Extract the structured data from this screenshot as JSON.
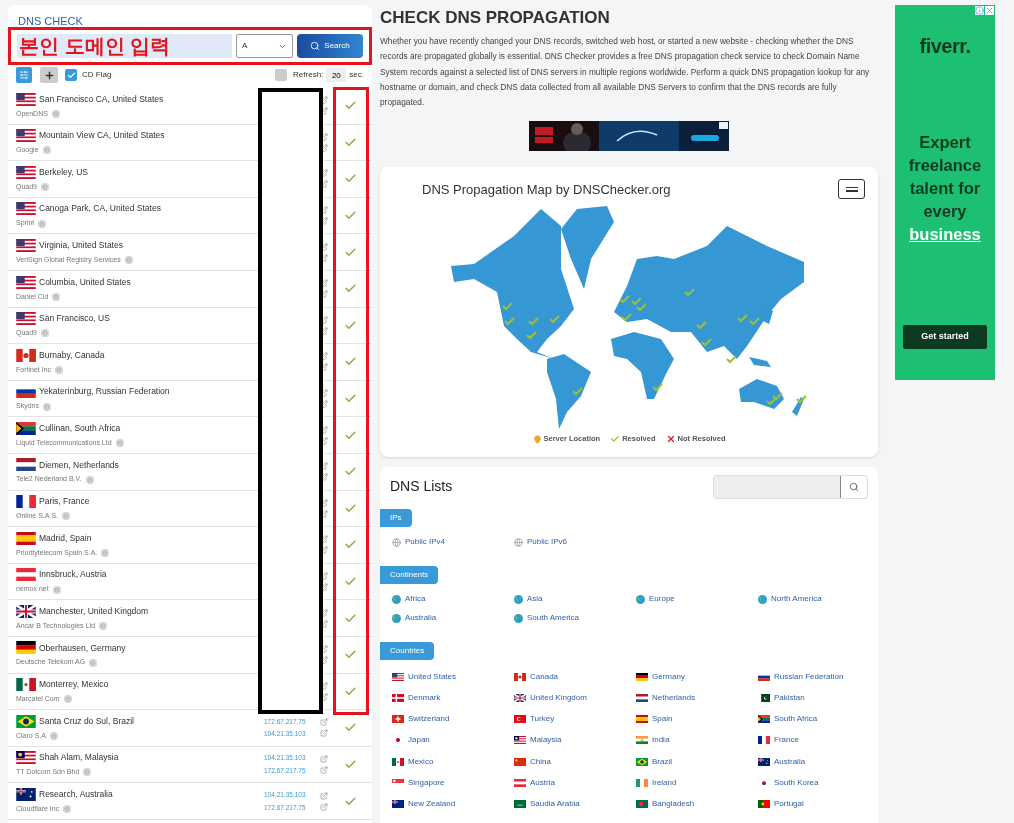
{
  "dns_check": {
    "title": "DNS CHECK",
    "domain_field": {
      "value": "본인 도메인 입력"
    },
    "record_type": "A",
    "search_button": "Search",
    "cd_flag": {
      "label": "CD Flag",
      "checked": true
    },
    "refresh": {
      "checked": false,
      "label": "Refresh:",
      "value": "20",
      "unit": "sec."
    }
  },
  "servers": [
    {
      "flag": {
        "kind": "us"
      },
      "location": "San Francisco CA, United States",
      "provider": "OpenDNS",
      "resolved": true
    },
    {
      "flag": {
        "kind": "us"
      },
      "location": "Mountain View CA, United States",
      "provider": "Google",
      "resolved": true
    },
    {
      "flag": {
        "kind": "us"
      },
      "location": "Berkeley, US",
      "provider": "Quad9",
      "resolved": true
    },
    {
      "flag": {
        "kind": "us"
      },
      "location": "Canoga Park, CA, United States",
      "provider": "Sprint",
      "resolved": true
    },
    {
      "flag": {
        "kind": "us"
      },
      "location": "Virginia, United States",
      "provider": "VeriSign Global Registry Services",
      "resolved": true
    },
    {
      "flag": {
        "kind": "us"
      },
      "location": "Columbia, United States",
      "provider": "Daniel Cid",
      "resolved": true
    },
    {
      "flag": {
        "kind": "us"
      },
      "location": "San Francisco, US",
      "provider": "Quad9",
      "resolved": true
    },
    {
      "flag": {
        "kind": "ca"
      },
      "location": "Burnaby, Canada",
      "provider": "Fortinet Inc",
      "resolved": true
    },
    {
      "flag": {
        "kind": "ru"
      },
      "location": "Yekaterinburg, Russian Federation",
      "provider": "Skydns",
      "resolved": true
    },
    {
      "flag": {
        "kind": "za"
      },
      "location": "Cullinan, South Africa",
      "provider": "Liquid Telecommunications Ltd",
      "resolved": true
    },
    {
      "flag": {
        "kind": "nl"
      },
      "location": "Diemen, Netherlands",
      "provider": "Tele2 Nederland B.V.",
      "resolved": true
    },
    {
      "flag": {
        "kind": "fr"
      },
      "location": "Paris, France",
      "provider": "Online S.A.S.",
      "resolved": true
    },
    {
      "flag": {
        "kind": "es"
      },
      "location": "Madrid, Spain",
      "provider": "Prioritytelecom Spain S.A.",
      "resolved": true
    },
    {
      "flag": {
        "kind": "at"
      },
      "location": "Innsbruck, Austria",
      "provider": "nemox.net",
      "resolved": true
    },
    {
      "flag": {
        "kind": "gb"
      },
      "location": "Manchester, United Kingdom",
      "provider": "Ancar B Technologies Ltd",
      "resolved": true
    },
    {
      "flag": {
        "kind": "de"
      },
      "location": "Oberhausen, Germany",
      "provider": "Deutsche Telekom AG",
      "resolved": true
    },
    {
      "flag": {
        "kind": "mx"
      },
      "location": "Monterrey, Mexico",
      "provider": "Marcatel Com",
      "resolved": true
    },
    {
      "flag": {
        "kind": "br"
      },
      "location": "Santa Cruz do Sul, Brazil",
      "provider": "Claro S.A",
      "ips": [
        "172.67.217.75",
        "104.21.35.103"
      ],
      "resolved": true
    },
    {
      "flag": {
        "kind": "my"
      },
      "location": "Shah Alam, Malaysia",
      "provider": "TT Dotcom Sdn Bhd",
      "ips": [
        "104.21.35.103",
        "172.67.217.75"
      ],
      "resolved": true
    },
    {
      "flag": {
        "kind": "au"
      },
      "location": "Research, Australia",
      "provider": "Cloudflare Inc",
      "ips": [
        "104.21.35.103",
        "172.67.217.75"
      ],
      "resolved": true
    }
  ],
  "intro": {
    "title": "CHECK DNS PROPAGATION",
    "text": "Whether you have recently changed your DNS records, switched web host, or started a new website - checking whether the DNS records are propagated globally is essential. DNS Checker provides a free DNS propagation check service to check Domain Name System records against a selected list of DNS servers in multiple regions worldwide. Perform a quick DNS propagation lookup for any hostname or domain, and check DNS data collected from all available DNS Servers to confirm that the DNS records are fully propagated."
  },
  "map": {
    "title": "DNS Propagation Map by DNSChecker.org",
    "legend": [
      {
        "kind": "pin",
        "label": "Server Location"
      },
      {
        "kind": "check",
        "label": "Resolved"
      },
      {
        "kind": "cross",
        "label": "Not Resolved"
      }
    ]
  },
  "dns_lists": {
    "title": "DNS Lists",
    "sections": [
      {
        "title": "IPs",
        "items": [
          {
            "kind": "ip",
            "label": "Public IPv4"
          },
          {
            "kind": "ip",
            "label": "Public IPv6"
          }
        ]
      },
      {
        "title": "Continents",
        "items": [
          {
            "kind": "continent",
            "label": "Africa"
          },
          {
            "kind": "continent",
            "label": "Asia"
          },
          {
            "kind": "continent",
            "label": "Europe"
          },
          {
            "kind": "continent",
            "label": "North America"
          },
          {
            "kind": "continent",
            "label": "Australia"
          },
          {
            "kind": "continent",
            "label": "South America"
          }
        ]
      },
      {
        "title": "Countries",
        "items": [
          {
            "kind": "country",
            "flag": {
              "kind": "us"
            },
            "label": "United States"
          },
          {
            "kind": "country",
            "flag": {
              "kind": "ca"
            },
            "label": "Canada"
          },
          {
            "kind": "country",
            "flag": {
              "kind": "de"
            },
            "label": "Germany"
          },
          {
            "kind": "country",
            "flag": {
              "kind": "ru"
            },
            "label": "Russian Federation"
          },
          {
            "kind": "country",
            "flag": {
              "kind": "dk"
            },
            "label": "Denmark"
          },
          {
            "kind": "country",
            "flag": {
              "kind": "gb"
            },
            "label": "United Kingdom"
          },
          {
            "kind": "country",
            "flag": {
              "kind": "nl"
            },
            "label": "Netherlands"
          },
          {
            "kind": "country",
            "flag": {
              "kind": "pk"
            },
            "label": "Pakistan"
          },
          {
            "kind": "country",
            "flag": {
              "kind": "ch"
            },
            "label": "Switzerland"
          },
          {
            "kind": "country",
            "flag": {
              "kind": "tr"
            },
            "label": "Turkey"
          },
          {
            "kind": "country",
            "flag": {
              "kind": "es"
            },
            "label": "Spain"
          },
          {
            "kind": "country",
            "flag": {
              "kind": "za"
            },
            "label": "South Africa"
          },
          {
            "kind": "country",
            "flag": {
              "kind": "jp"
            },
            "label": "Japan"
          },
          {
            "kind": "country",
            "flag": {
              "kind": "my"
            },
            "label": "Malaysia"
          },
          {
            "kind": "country",
            "flag": {
              "kind": "in"
            },
            "label": "India"
          },
          {
            "kind": "country",
            "flag": {
              "kind": "fr"
            },
            "label": "France"
          },
          {
            "kind": "country",
            "flag": {
              "kind": "mx"
            },
            "label": "Mexico"
          },
          {
            "kind": "country",
            "flag": {
              "kind": "cn"
            },
            "label": "China"
          },
          {
            "kind": "country",
            "flag": {
              "kind": "br"
            },
            "label": "Brazil"
          },
          {
            "kind": "country",
            "flag": {
              "kind": "au"
            },
            "label": "Australia"
          },
          {
            "kind": "country",
            "flag": {
              "kind": "sg"
            },
            "label": "Singapore"
          },
          {
            "kind": "country",
            "flag": {
              "kind": "at"
            },
            "label": "Austria"
          },
          {
            "kind": "country",
            "flag": {
              "kind": "ie"
            },
            "label": "Ireland"
          },
          {
            "kind": "country",
            "flag": {
              "kind": "kr"
            },
            "label": "South Korea"
          },
          {
            "kind": "country",
            "flag": {
              "kind": "nz"
            },
            "label": "New Zealand"
          },
          {
            "kind": "country",
            "flag": {
              "kind": "sa"
            },
            "label": "Saudia Arabia"
          },
          {
            "kind": "country",
            "flag": {
              "kind": "bd"
            },
            "label": "Bangladesh"
          },
          {
            "kind": "country",
            "flag": {
              "kind": "pt"
            },
            "label": "Portugal"
          }
        ]
      }
    ]
  },
  "side_ad": {
    "logo": "fiverr.",
    "headline": "Expert freelance talent for every",
    "highlight": "business",
    "button": "Get started"
  }
}
